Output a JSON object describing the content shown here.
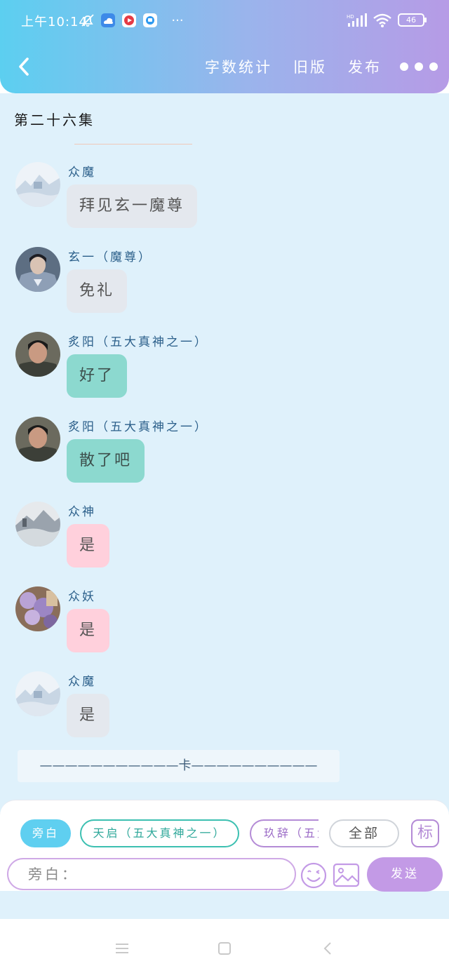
{
  "status_bar": {
    "time": "上午10:14",
    "dots": "···",
    "battery": "46",
    "hd_label": "HD"
  },
  "header": {
    "nav_items": [
      "字数统计",
      "旧版",
      "发布"
    ]
  },
  "chat": {
    "episode_title": "第二十六集",
    "messages": [
      {
        "speaker": "众魔",
        "text": "拜见玄一魔尊",
        "style": "grey",
        "avatar": "misty-landscape"
      },
      {
        "speaker": "玄一（魔尊）",
        "text": "免礼",
        "style": "grey",
        "avatar": "man-dark-robe"
      },
      {
        "speaker": "炙阳（五大真神之一）",
        "text": "好了",
        "style": "teal",
        "avatar": "man-portrait"
      },
      {
        "speaker": "炙阳（五大真神之一）",
        "text": "散了吧",
        "style": "teal",
        "avatar": "man-portrait"
      },
      {
        "speaker": "众神",
        "text": "是",
        "style": "pink",
        "avatar": "foggy-mountain"
      },
      {
        "speaker": "众妖",
        "text": "是",
        "style": "pink",
        "avatar": "purple-blossoms"
      },
      {
        "speaker": "众魔",
        "text": "是",
        "style": "grey",
        "avatar": "misty-landscape"
      }
    ],
    "cut_text": "———————————卡——————————"
  },
  "input_panel": {
    "role_chips": [
      "旁白",
      "天启（五大真神之一）",
      "玖辞（五大真神之一）"
    ],
    "all_label": "全部",
    "mark_label": "标",
    "input_placeholder": "旁白：",
    "send_label": "发送"
  },
  "colors": {
    "header_start": "#5ccff0",
    "header_end": "#b69be6",
    "chat_bg": "#dff1fb",
    "bubble_grey": "#e4e8ee",
    "bubble_teal": "#8cd9cf",
    "bubble_pink": "#ffd0dc",
    "speaker_text": "#2b5f8a",
    "send_button": "#c39ae6"
  }
}
